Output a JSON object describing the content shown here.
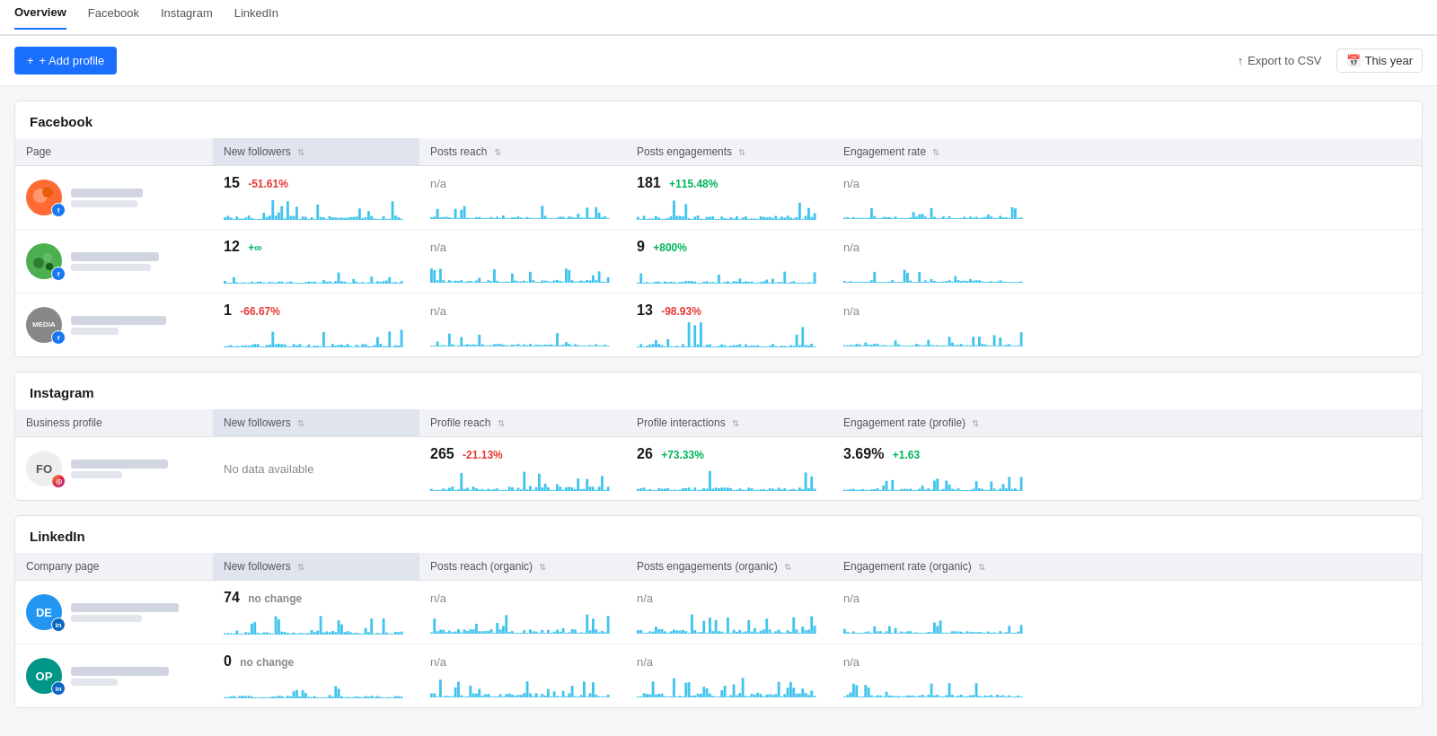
{
  "nav": {
    "items": [
      {
        "label": "Overview",
        "active": true
      },
      {
        "label": "Facebook",
        "active": false
      },
      {
        "label": "Instagram",
        "active": false
      },
      {
        "label": "LinkedIn",
        "active": false
      }
    ]
  },
  "toolbar": {
    "add_profile_label": "+ Add profile",
    "export_label": "Export to CSV",
    "date_label": "This year"
  },
  "facebook": {
    "title": "Facebook",
    "col_page": "Page",
    "col_new_followers": "New followers",
    "col_posts_reach": "Posts reach",
    "col_posts_engagements": "Posts engagements",
    "col_engagement_rate": "Engagement rate",
    "rows": [
      {
        "avatar_initials": "",
        "avatar_class": "av-orange",
        "badge": "fb",
        "new_followers": "15",
        "new_followers_change": "-51.61%",
        "new_followers_change_type": "negative",
        "posts_reach": "n/a",
        "posts_engagements": "181",
        "posts_engagements_change": "+115.48%",
        "posts_engagements_change_type": "positive",
        "engagement_rate": "n/a"
      },
      {
        "avatar_initials": "",
        "avatar_class": "av-green",
        "badge": "fb",
        "new_followers": "12",
        "new_followers_change": "+∞",
        "new_followers_change_type": "positive",
        "posts_reach": "n/a",
        "posts_engagements": "9",
        "posts_engagements_change": "+800%",
        "posts_engagements_change_type": "positive",
        "engagement_rate": "n/a"
      },
      {
        "avatar_initials": "MEDIA",
        "avatar_class": "av-gray",
        "badge": "fb",
        "new_followers": "1",
        "new_followers_change": "-66.67%",
        "new_followers_change_type": "negative",
        "posts_reach": "n/a",
        "posts_engagements": "13",
        "posts_engagements_change": "-98.93%",
        "posts_engagements_change_type": "negative",
        "engagement_rate": "n/a"
      }
    ]
  },
  "instagram": {
    "title": "Instagram",
    "col_profile": "Business profile",
    "col_new_followers": "New followers",
    "col_profile_reach": "Profile reach",
    "col_profile_interactions": "Profile interactions",
    "col_engagement_rate": "Engagement rate (profile)",
    "rows": [
      {
        "avatar_initials": "FO",
        "avatar_class": "av-white",
        "badge": "ig",
        "new_followers": "No data available",
        "new_followers_type": "nodata",
        "profile_reach": "265",
        "profile_reach_change": "-21.13%",
        "profile_reach_change_type": "negative",
        "profile_interactions": "26",
        "profile_interactions_change": "+73.33%",
        "profile_interactions_change_type": "positive",
        "engagement_rate": "3.69%",
        "engagement_rate_change": "+1.63",
        "engagement_rate_change_type": "positive"
      }
    ]
  },
  "linkedin": {
    "title": "LinkedIn",
    "col_company": "Company page",
    "col_new_followers": "New followers",
    "col_posts_reach": "Posts reach (organic)",
    "col_posts_engagements": "Posts engagements (organic)",
    "col_engagement_rate": "Engagement rate (organic)",
    "rows": [
      {
        "avatar_initials": "DE",
        "avatar_class": "av-blue",
        "badge": "li",
        "new_followers": "74",
        "new_followers_change": "no change",
        "new_followers_change_type": "neutral",
        "posts_reach": "n/a",
        "posts_engagements": "n/a",
        "engagement_rate": "n/a"
      },
      {
        "avatar_initials": "OP",
        "avatar_class": "av-teal",
        "badge": "li",
        "new_followers": "0",
        "new_followers_change": "no change",
        "new_followers_change_type": "neutral",
        "posts_reach": "n/a",
        "posts_engagements": "n/a",
        "engagement_rate": "n/a"
      }
    ]
  }
}
